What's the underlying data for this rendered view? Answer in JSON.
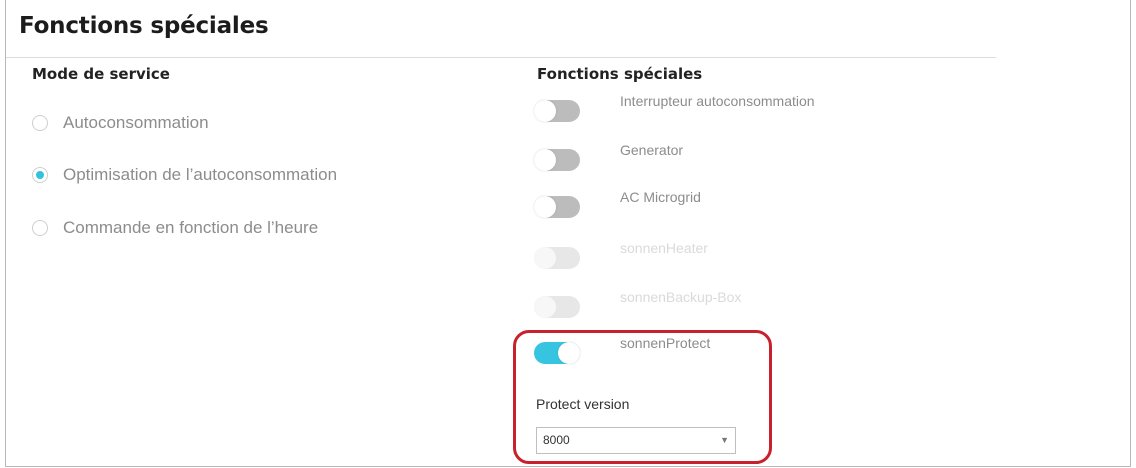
{
  "page_title": "Fonctions spéciales",
  "service_mode": {
    "heading": "Mode de service",
    "options": [
      {
        "label": "Autoconsommation",
        "checked": false
      },
      {
        "label": "Optimisation de l’autoconsommation",
        "checked": true
      },
      {
        "label": "Commande en fonction de l’heure",
        "checked": false
      }
    ]
  },
  "special_functions": {
    "heading": "Fonctions spéciales",
    "toggles": [
      {
        "label": "Interrupteur autoconsommation",
        "state": "off"
      },
      {
        "label": "Generator",
        "state": "off"
      },
      {
        "label": "AC Microgrid",
        "state": "off"
      },
      {
        "label": "sonnenHeater",
        "state": "disabled"
      },
      {
        "label": "sonnenBackup-Box",
        "state": "disabled"
      },
      {
        "label": "sonnenProtect",
        "state": "on"
      }
    ],
    "protect_version": {
      "label": "Protect version",
      "selected": "8000"
    }
  },
  "colors": {
    "accent": "#37c4e0",
    "highlight_border": "#c8202d",
    "toggle_off": "#bcbcbc",
    "toggle_disabled": "#e7e7e7"
  },
  "icons": {
    "select_caret": "▼"
  }
}
